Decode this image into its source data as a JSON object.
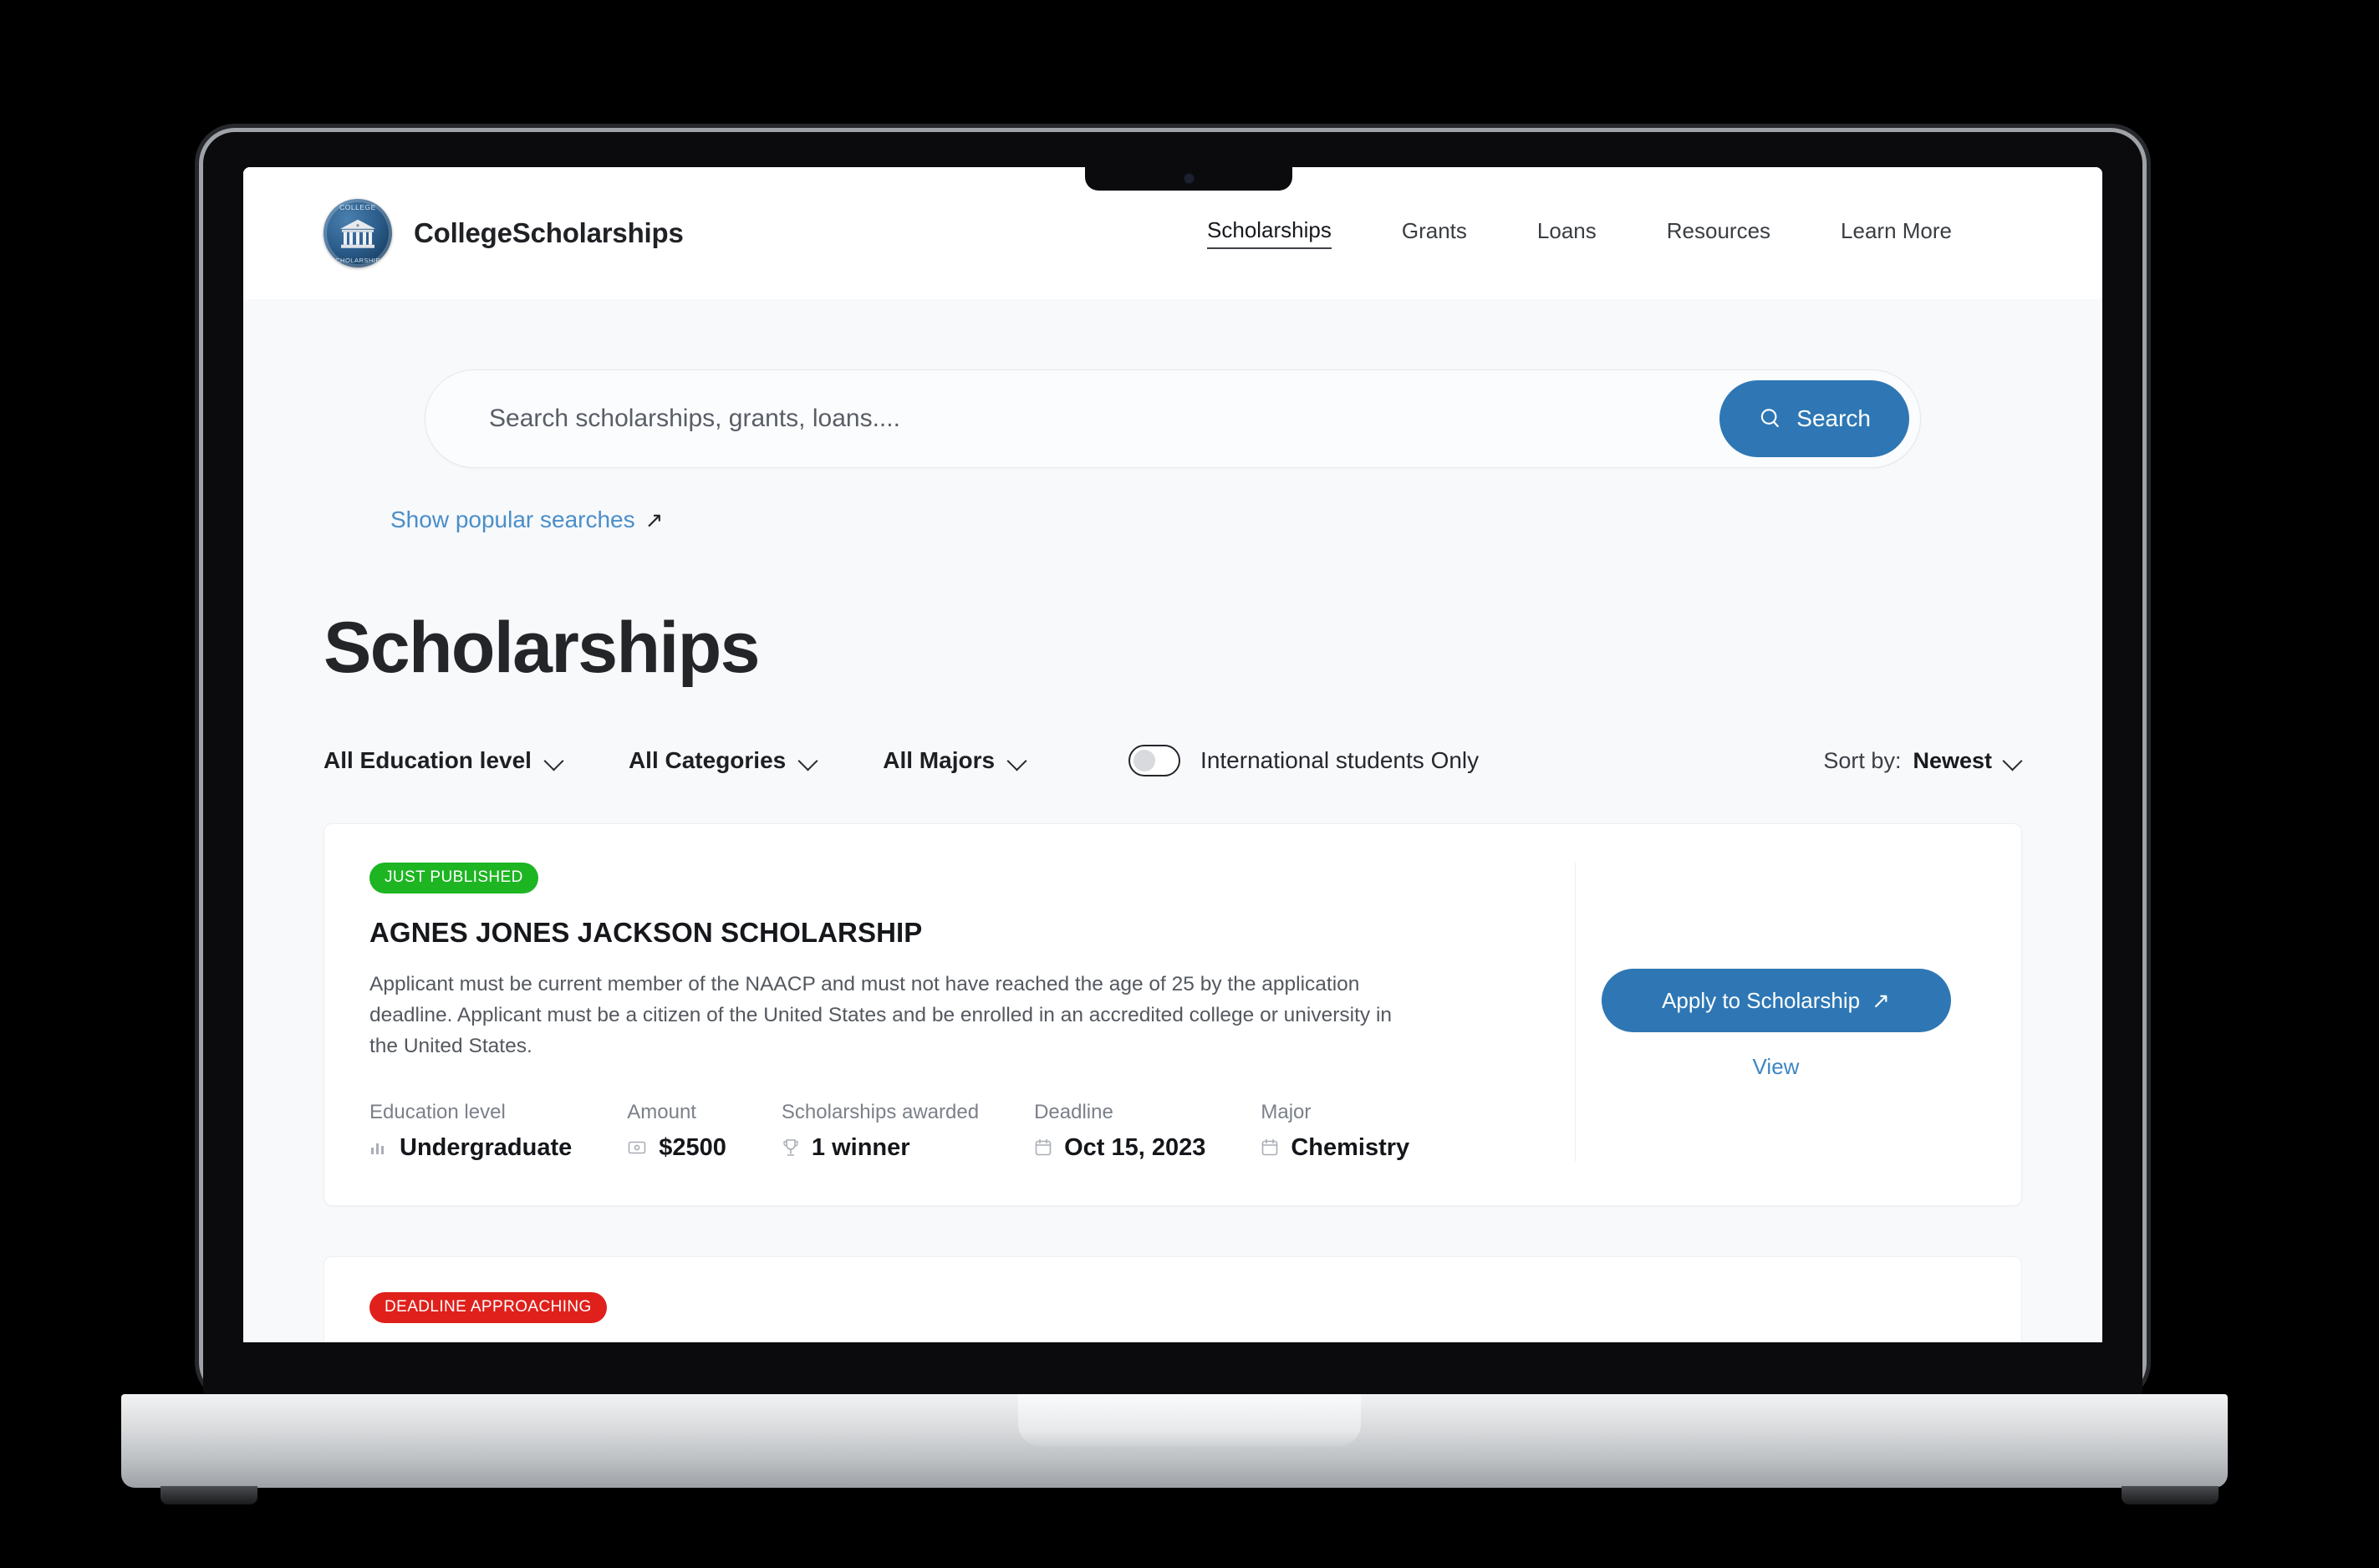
{
  "header": {
    "brand_name": "CollegeScholarships",
    "logo": {
      "icon": "college-seal-icon",
      "rim_top": "COLLEGE",
      "rim_bottom": "SCHOLARSHIPS"
    },
    "nav": [
      {
        "label": "Scholarships",
        "active": true
      },
      {
        "label": "Grants",
        "active": false
      },
      {
        "label": "Loans",
        "active": false
      },
      {
        "label": "Resources",
        "active": false
      },
      {
        "label": "Learn More",
        "active": false
      }
    ]
  },
  "search": {
    "placeholder": "Search scholarships, grants, loans....",
    "value": "",
    "button_label": "Search",
    "button_icon": "search-icon",
    "popular_label": "Show popular searches",
    "popular_icon": "arrow-up-right-icon"
  },
  "page": {
    "title": "Scholarships"
  },
  "filters": {
    "education_level": "All Education level",
    "categories": "All Categories",
    "majors": "All Majors",
    "international_toggle_label": "International students Only",
    "international_toggle_state": "off",
    "sort_label": "Sort by:",
    "sort_value": "Newest",
    "chevron_icon": "chevron-down-icon"
  },
  "cards": [
    {
      "badge": "JUST PUBLISHED",
      "badge_color": "#1db522",
      "title": "AGNES JONES JACKSON SCHOLARSHIP",
      "description": "Applicant must be current member of the NAACP and must not have reached the age of 25 by the application deadline. Applicant must be a citizen of the United States and be enrolled in an accredited college or university in the United States.",
      "meta": [
        {
          "label": "Education level",
          "value": "Undergraduate",
          "icon": "bar-chart-icon"
        },
        {
          "label": "Amount",
          "value": "$2500",
          "icon": "money-icon"
        },
        {
          "label": "Scholarships awarded",
          "value": "1 winner",
          "icon": "trophy-icon"
        },
        {
          "label": "Deadline",
          "value": "Oct 15, 2023",
          "icon": "calendar-icon"
        },
        {
          "label": "Major",
          "value": "Chemistry",
          "icon": "calendar-icon"
        }
      ],
      "apply_label": "Apply to Scholarship",
      "apply_icon": "arrow-up-right-icon",
      "view_label": "View"
    },
    {
      "badge": "DEADLINE APPROACHING",
      "badge_color": "#e0201b"
    }
  ],
  "colors": {
    "accent_blue": "#2e77b4",
    "link_blue": "#3d86c4",
    "badge_green": "#1db522",
    "badge_red": "#e0201b",
    "page_background": "#f7f9fb",
    "text_dark": "#15171b"
  }
}
